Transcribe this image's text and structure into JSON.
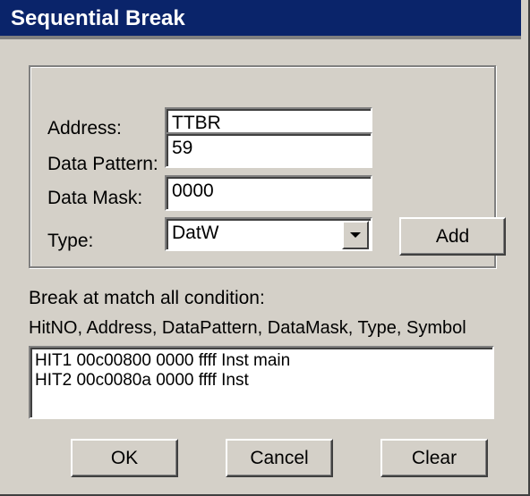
{
  "window": {
    "title": "Sequential Break"
  },
  "form": {
    "address_label": "Address:",
    "address_value": "TTBR",
    "pattern_label": "Data Pattern:",
    "pattern_value": "59",
    "mask_label": "Data Mask:",
    "mask_value": "0000",
    "type_label": "Type:",
    "type_value": "DatW",
    "add_label": "Add"
  },
  "info": {
    "condition_text": "Break at match all condition:",
    "columns_text": "HitNO, Address, DataPattern, DataMask, Type, Symbol"
  },
  "hits": [
    "HIT1 00c00800 0000 ffff Inst main",
    "HIT2 00c0080a 0000 ffff Inst"
  ],
  "buttons": {
    "ok": "OK",
    "cancel": "Cancel",
    "clear": "Clear"
  },
  "icons": {
    "dropdown": "chevron-down-icon"
  }
}
